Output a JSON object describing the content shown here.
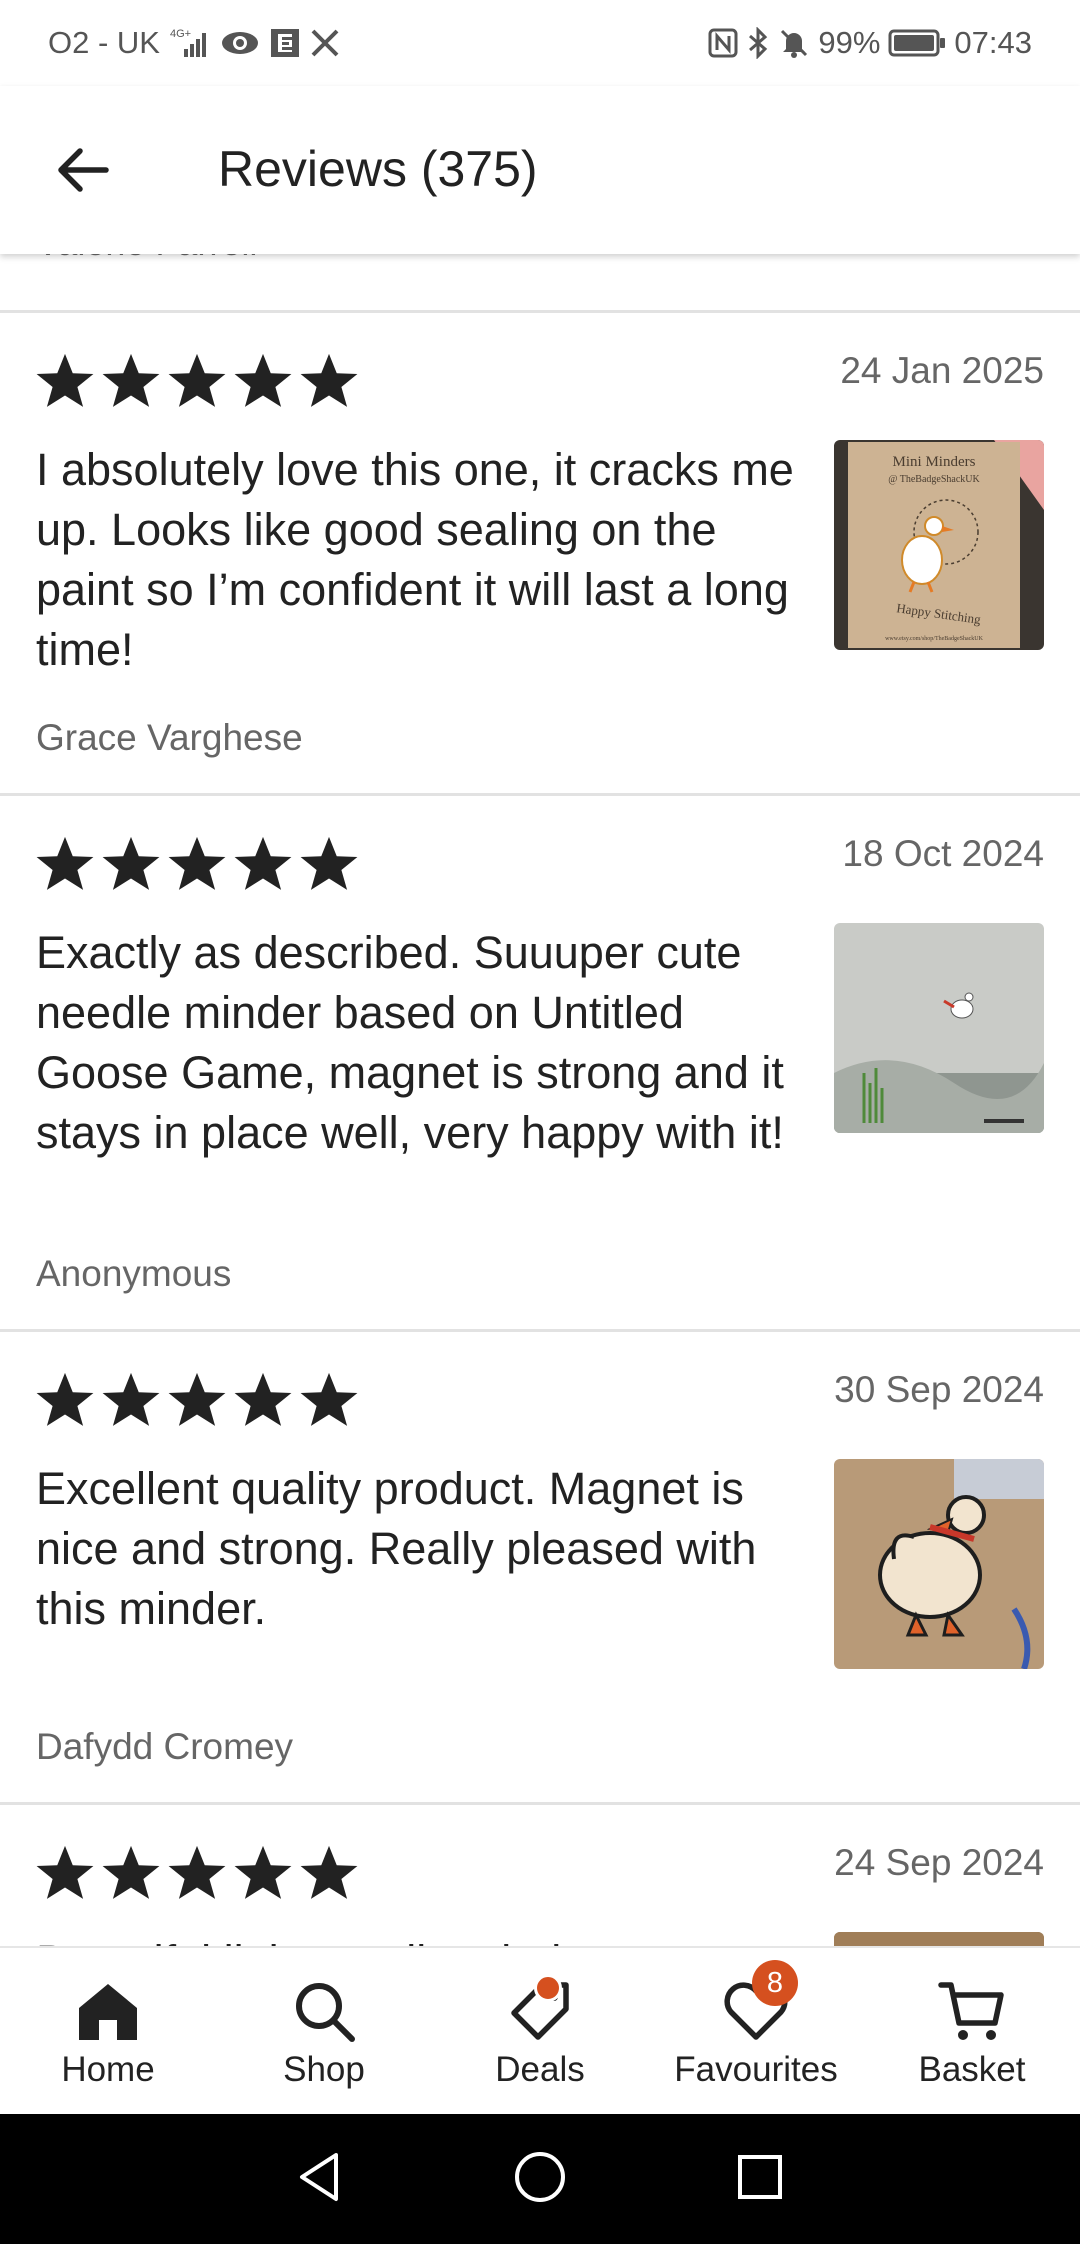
{
  "status_bar": {
    "carrier": "O2 - UK",
    "network": "4G+",
    "bell_text": "",
    "battery": "99%",
    "time": "07:43"
  },
  "header": {
    "title": "Reviews (375)",
    "back_icon": "arrow-left-icon"
  },
  "partial_review": {
    "author": "Valerie Farrell"
  },
  "reviews": [
    {
      "rating": 5,
      "date": "24 Jan 2025",
      "text": "I absolutely love this one, it cracks me up. Looks like good sealing on the paint so I’m confident it will last a long time!",
      "author": "Grace Varghese",
      "photo": {
        "title": "Mini Minders",
        "handle": "@ TheBadgeShackUK",
        "footer": "Happy Stitching",
        "url": "www.etsy.com/shop/TheBadgeShackUK"
      }
    },
    {
      "rating": 5,
      "date": "18 Oct 2024",
      "text": "Exactly as described. Suuuper cute needle minder based on Untitled Goose Game, magnet is strong and it stays in place well, very happy with it!",
      "author": "Anonymous"
    },
    {
      "rating": 5,
      "date": "30 Sep 2024",
      "text": "Excellent quality product. Magnet is nice and strong. Really pleased with this minder.",
      "author": "Dafydd Cromey"
    },
    {
      "rating": 5,
      "date": "24 Sep 2024",
      "text": "Beautiful little needle minder",
      "author": ""
    }
  ],
  "bottom_nav": {
    "items": [
      {
        "label": "Home",
        "icon": "home-icon",
        "active": true
      },
      {
        "label": "Shop",
        "icon": "search-icon"
      },
      {
        "label": "Deals",
        "icon": "tag-icon"
      },
      {
        "label": "Favourites",
        "icon": "heart-icon",
        "badge": "8"
      },
      {
        "label": "Basket",
        "icon": "cart-icon"
      }
    ]
  },
  "colors": {
    "accent": "#d5501f",
    "text": "#222222",
    "muted": "#666666",
    "divider": "#e2e2e2"
  }
}
